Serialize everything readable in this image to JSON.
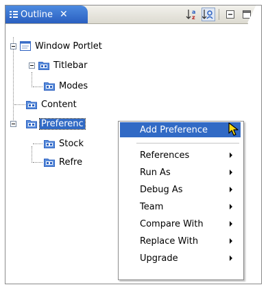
{
  "view": {
    "title": "Outline",
    "close_glyph": "✕",
    "toolbar_icons": [
      "sort-alphabetically-icon",
      "hide-fields-icon",
      "minimize-icon",
      "maximize-icon"
    ]
  },
  "tree": {
    "root": "Window Portlet",
    "titlebar": "Titlebar",
    "modes": "Modes",
    "content": "Content",
    "preferences": "Preferenc",
    "stock": "Stock",
    "refresh": "Refre"
  },
  "context_menu": {
    "add_preference": "Add Preference",
    "references": "References",
    "run_as": "Run As",
    "debug_as": "Debug As",
    "team": "Team",
    "compare_with": "Compare With",
    "replace_with": "Replace With",
    "upgrade": "Upgrade"
  },
  "colors": {
    "tab_blue": "#2a5fc0",
    "selection_blue": "#316ac5",
    "folder_blue": "#3a6ec8"
  }
}
